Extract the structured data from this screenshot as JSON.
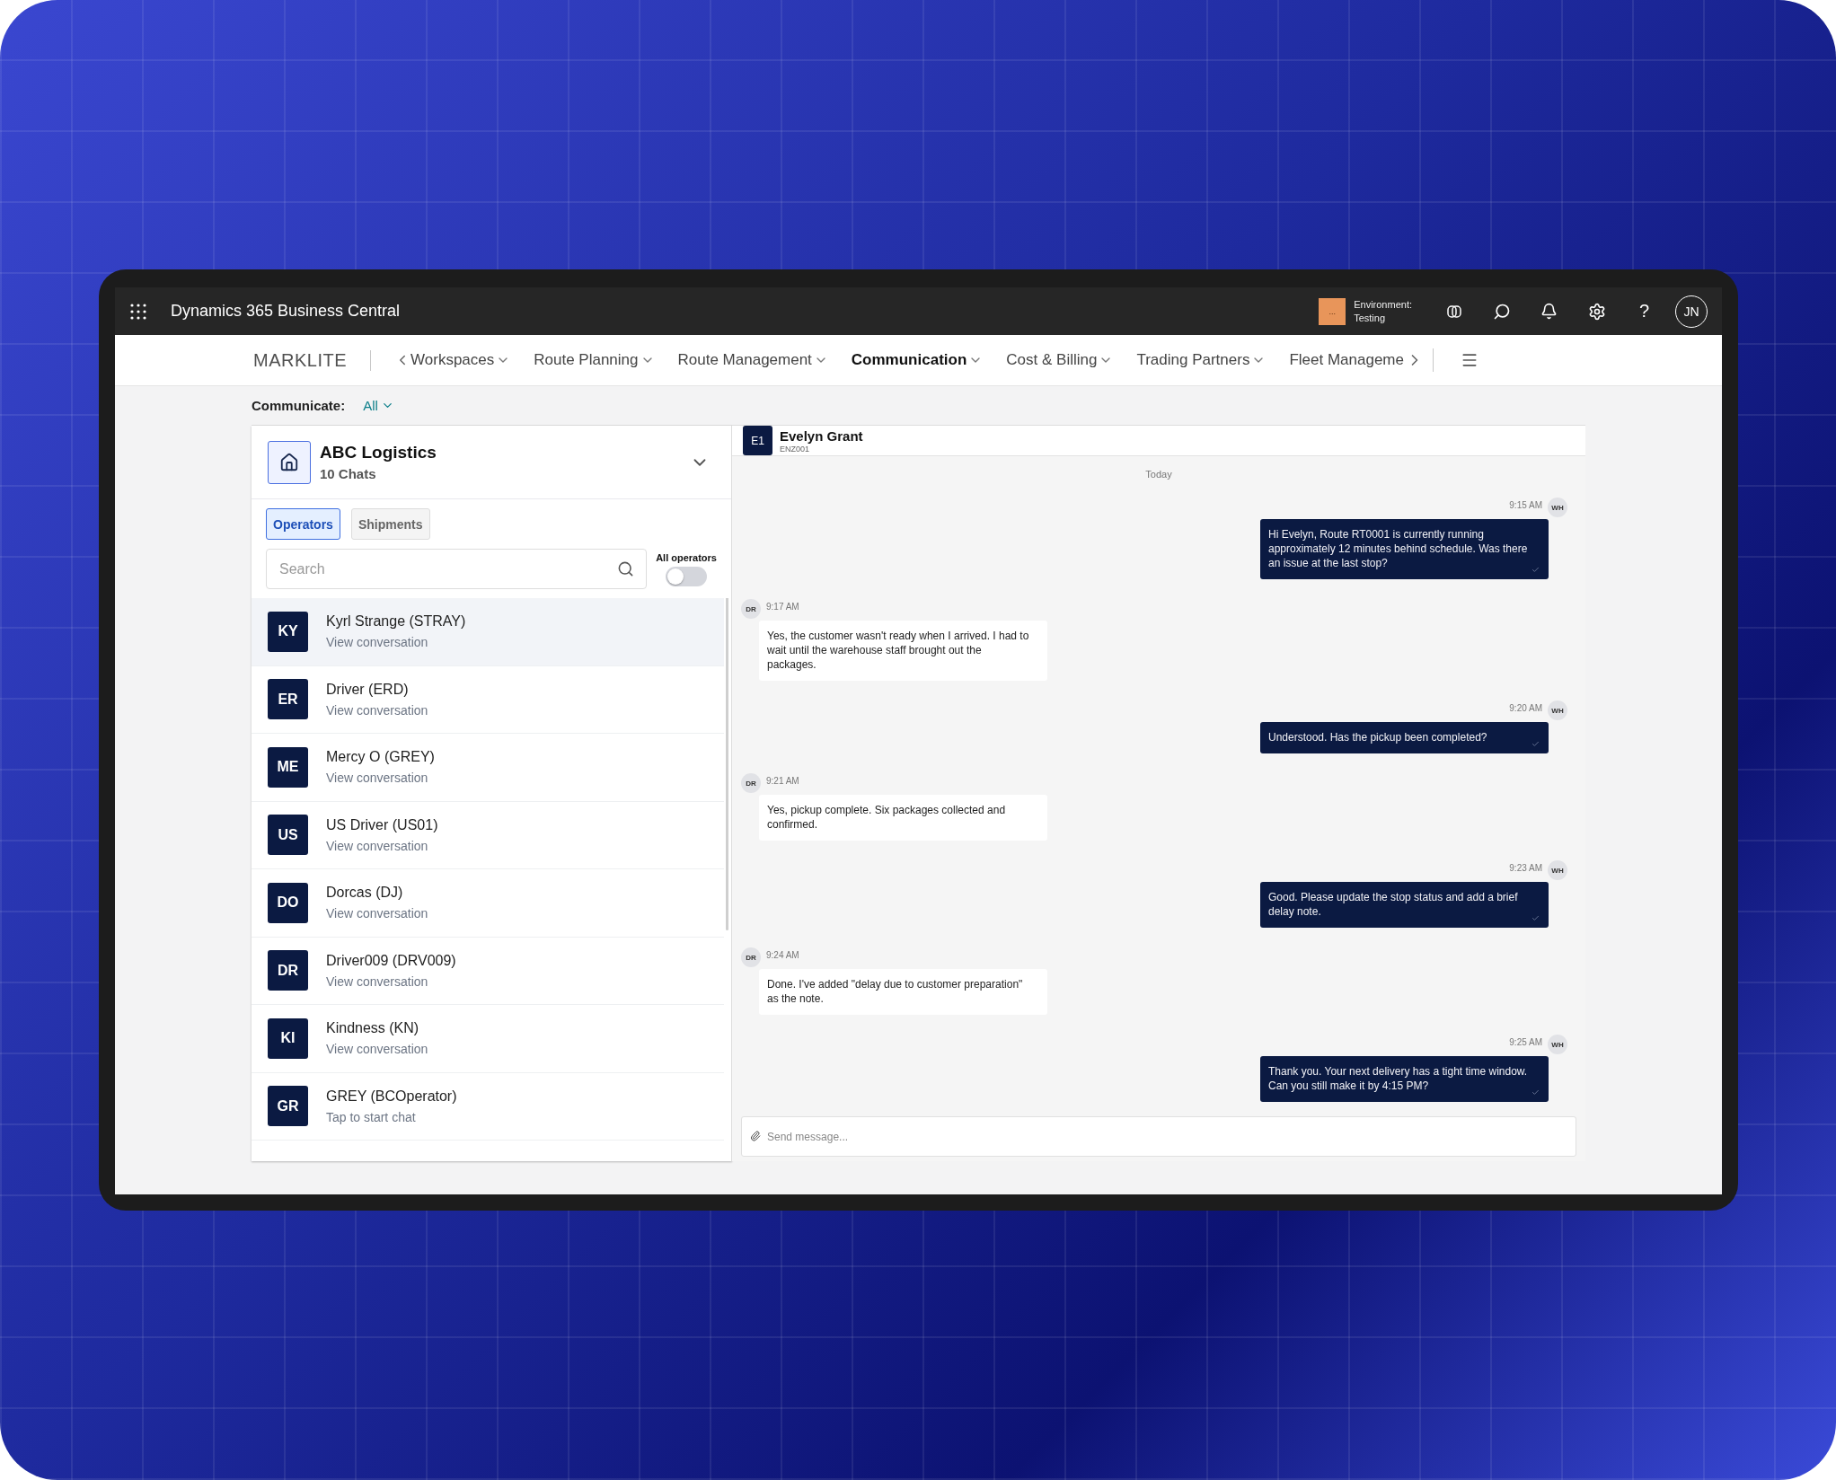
{
  "app_bar": {
    "title": "Dynamics 365 Business Central",
    "environment_label": "Environment:",
    "environment_value": "Testing",
    "environment_badge": "...",
    "user_initials": "JN",
    "help_glyph": "?"
  },
  "nav": {
    "brand": "MARKLITE",
    "items": [
      {
        "label": "Workspaces",
        "selected": false
      },
      {
        "label": "Route Planning",
        "selected": false
      },
      {
        "label": "Route Management",
        "selected": false
      },
      {
        "label": "Communication",
        "selected": true
      },
      {
        "label": "Cost & Billing",
        "selected": false
      },
      {
        "label": "Trading Partners",
        "selected": false
      },
      {
        "label": "Fleet Manageme",
        "selected": false
      }
    ]
  },
  "filter": {
    "label": "Communicate:",
    "value": "All"
  },
  "company": {
    "name": "ABC Logistics",
    "subtitle": "10 Chats"
  },
  "tabs": [
    {
      "label": "Operators",
      "selected": true
    },
    {
      "label": "Shipments",
      "selected": false
    }
  ],
  "search": {
    "placeholder": "Search"
  },
  "all_operators": {
    "label": "All operators",
    "on": false
  },
  "contacts": [
    {
      "initials": "KY",
      "name": "Kyrl Strange (STRAY)",
      "subtitle": "View conversation",
      "selected": true
    },
    {
      "initials": "ER",
      "name": "Driver (ERD)",
      "subtitle": "View conversation",
      "selected": false
    },
    {
      "initials": "ME",
      "name": "Mercy O (GREY)",
      "subtitle": "View conversation",
      "selected": false
    },
    {
      "initials": "US",
      "name": "US Driver (US01)",
      "subtitle": "View conversation",
      "selected": false
    },
    {
      "initials": "DO",
      "name": "Dorcas (DJ)",
      "subtitle": "View conversation",
      "selected": false
    },
    {
      "initials": "DR",
      "name": "Driver009 (DRV009)",
      "subtitle": "View conversation",
      "selected": false
    },
    {
      "initials": "KI",
      "name": "Kindness (KN)",
      "subtitle": "View conversation",
      "selected": false
    },
    {
      "initials": "GR",
      "name": "GREY (BCOperator)",
      "subtitle": "Tap to start chat",
      "selected": false
    }
  ],
  "chat": {
    "initials": "E1",
    "name": "Evelyn Grant",
    "code": "ENZ001",
    "day": "Today",
    "placeholder": "Send message...",
    "messages": [
      {
        "kind": "outgoing",
        "time": "9:15 AM",
        "avatar": "WH",
        "text": "Hi Evelyn, Route RT0001 is currently running approximately 12 minutes behind schedule. Was there an issue at the last stop?"
      },
      {
        "kind": "incoming",
        "time": "9:17 AM",
        "avatar": "DR",
        "text": "Yes, the customer wasn't ready when I arrived. I had to wait until the warehouse staff brought out the packages."
      },
      {
        "kind": "outgoing",
        "time": "9:20 AM",
        "avatar": "WH",
        "text": "Understood. Has the pickup been completed?"
      },
      {
        "kind": "incoming",
        "time": "9:21 AM",
        "avatar": "DR",
        "text": "Yes, pickup complete. Six packages collected and confirmed."
      },
      {
        "kind": "outgoing",
        "time": "9:23 AM",
        "avatar": "WH",
        "text": "Good. Please update the stop status and add a brief delay note."
      },
      {
        "kind": "incoming",
        "time": "9:24 AM",
        "avatar": "DR",
        "text": "Done. I've added \"delay due to customer preparation\" as the note."
      },
      {
        "kind": "outgoing",
        "time": "9:25 AM",
        "avatar": "WH",
        "text": "Thank you. Your next delivery has a tight time window. Can you still make it by 4:15 PM?"
      }
    ]
  }
}
